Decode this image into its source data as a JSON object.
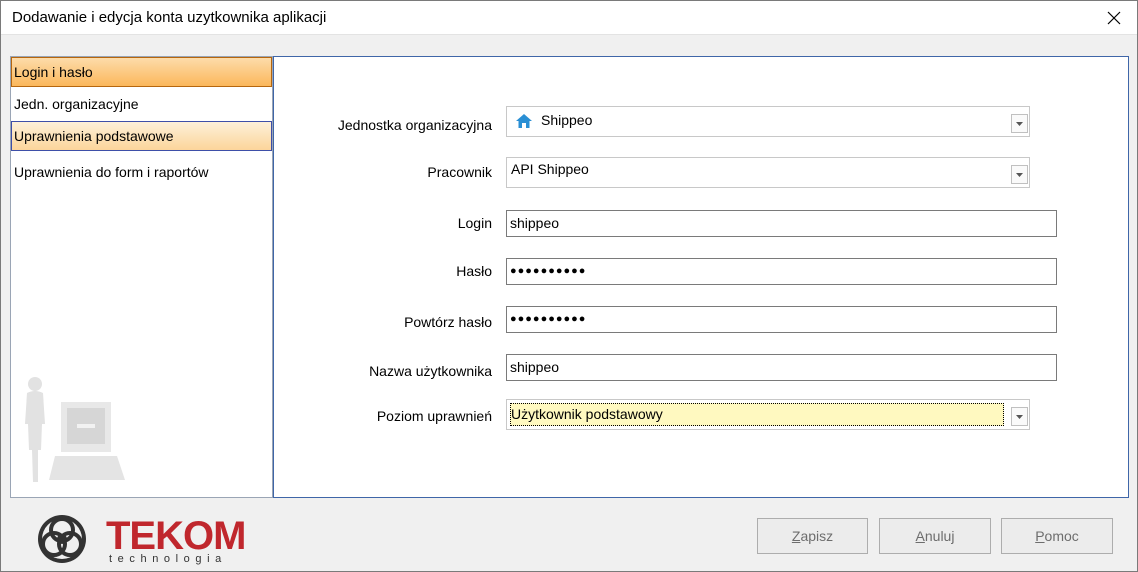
{
  "window": {
    "title": "Dodawanie i edycja konta uzytkownika aplikacji"
  },
  "sidebar": {
    "items": [
      {
        "label": "Login i hasło"
      },
      {
        "label": "Jedn. organizacyjne"
      },
      {
        "label": "Uprawnienia podstawowe"
      },
      {
        "label": "Uprawnienia do form i raportów"
      }
    ]
  },
  "form": {
    "unit": {
      "label": "Jednostka organizacyjna",
      "value": "Shippeo",
      "icon": "home-icon"
    },
    "employee": {
      "label": "Pracownik",
      "value": "API Shippeo"
    },
    "login": {
      "label": "Login",
      "value": "shippeo"
    },
    "password": {
      "label": "Hasło",
      "value": "●●●●●●●●●●"
    },
    "password_repeat": {
      "label": "Powtórz hasło",
      "value": "●●●●●●●●●●"
    },
    "username": {
      "label": "Nazwa użytkownika",
      "value": "shippeo"
    },
    "level": {
      "label": "Poziom uprawnień",
      "value": "Użytkownik podstawowy"
    }
  },
  "footer": {
    "logo_main": "TEKOM",
    "logo_sub": "technologia",
    "save_mnemonic": "Z",
    "save_rest": "apisz",
    "cancel_mnemonic": "A",
    "cancel_rest": "nuluj",
    "help_mnemonic": "P",
    "help_rest": "omoc"
  },
  "colors": {
    "selected_item": "#fbb75b",
    "hover_border": "#3e4fa8",
    "content_border": "#3f66a8",
    "brand_red": "#c0272d",
    "level_highlight": "#fff9c0",
    "home_icon": "#2a8fd4"
  }
}
